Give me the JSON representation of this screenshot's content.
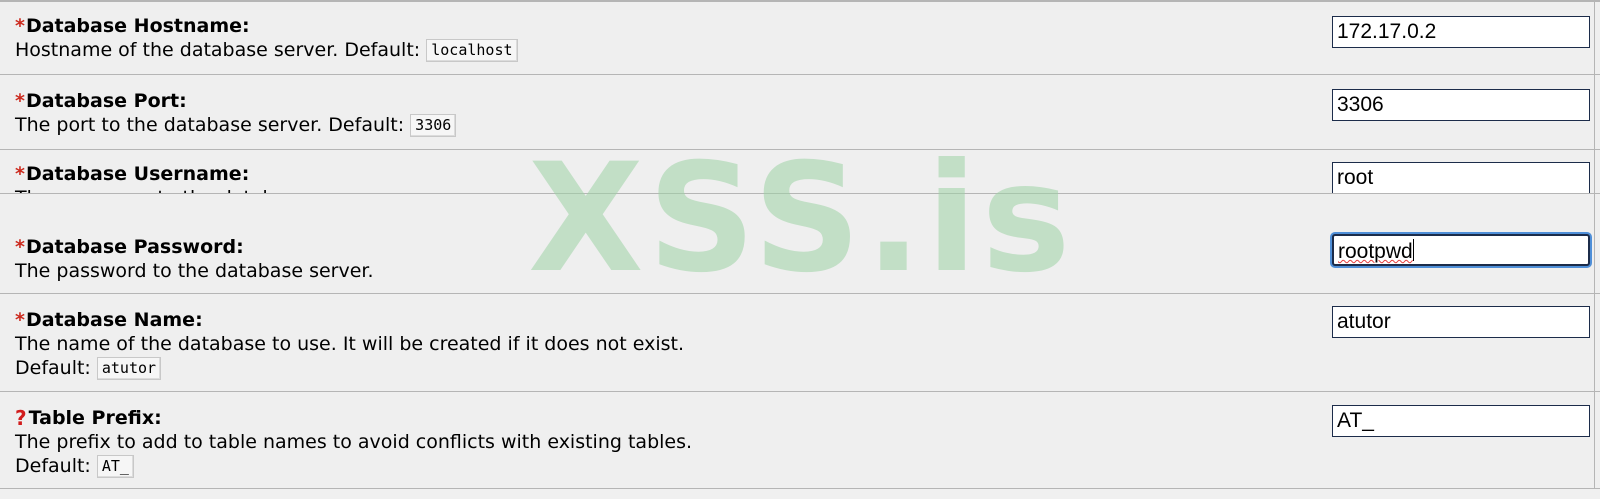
{
  "fields": [
    {
      "marker": "*",
      "label": "Database Hostname:",
      "desc": "Hostname of the database server. Default: ",
      "default": "localhost",
      "desc2": "",
      "value": "172.17.0.2"
    },
    {
      "marker": "*",
      "label": "Database Port:",
      "desc": "The port to the database server. Default: ",
      "default": "3306",
      "desc2": "",
      "value": "3306"
    },
    {
      "marker": "*",
      "label": "Database Username:",
      "desc": "The username to the database server.",
      "default": "",
      "desc2": "",
      "value": "root"
    },
    {
      "marker": "*",
      "label": "Database Password:",
      "desc": "The password to the database server.",
      "default": "",
      "desc2": "",
      "value": "rootpwd"
    },
    {
      "marker": "*",
      "label": "Database Name:",
      "desc": "The name of the database to use. It will be created if it does not exist.",
      "default": "atutor",
      "desc2": "Default: ",
      "value": "atutor"
    },
    {
      "marker": "?",
      "label": "Table Prefix:",
      "desc": "The prefix to add to table names to avoid conflicts with existing tables.",
      "default": "AT_",
      "desc2": "Default: ",
      "value": "AT_"
    }
  ],
  "watermark": "XSS.is",
  "colors": {
    "required": "#cc2a1e",
    "help": "#d11c1c",
    "background": "#efefef",
    "border": "#b5b5b5",
    "input_border": "#1c2c4a",
    "focus_ring": "#4f8fd8"
  }
}
